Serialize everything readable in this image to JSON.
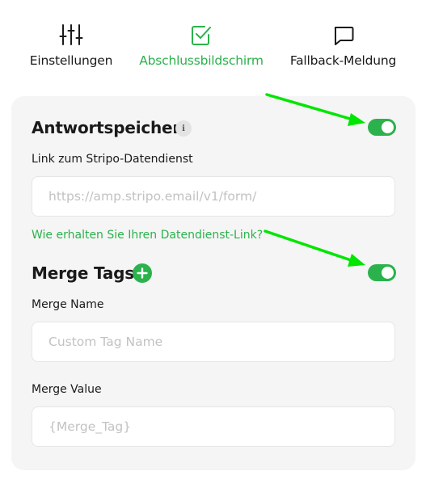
{
  "tabs": [
    {
      "label": "Einstellungen",
      "icon": "sliders-icon",
      "active": false
    },
    {
      "label": "Abschlussbildschirm",
      "icon": "checkbox-icon",
      "active": true
    },
    {
      "label": "Fallback-Meldung",
      "icon": "chat-bubble-icon",
      "active": false
    }
  ],
  "response_store": {
    "title": "Antwortspeicher",
    "info_glyph": "i",
    "enabled": true,
    "link_label": "Link zum Stripo-Datendienst",
    "link_placeholder": "https://amp.stripo.email/v1/form/",
    "help_link": "Wie erhalten Sie Ihren Datendienst-Link?"
  },
  "merge_tags": {
    "title": "Merge Tags",
    "enabled": true,
    "name_label": "Merge Name",
    "name_placeholder": "Custom Tag Name",
    "value_label": "Merge Value",
    "value_placeholder": "{Merge_Tag}"
  },
  "colors": {
    "accent": "#2bb24c",
    "panel_bg": "#f5f5f5",
    "arrow": "#00e600"
  }
}
